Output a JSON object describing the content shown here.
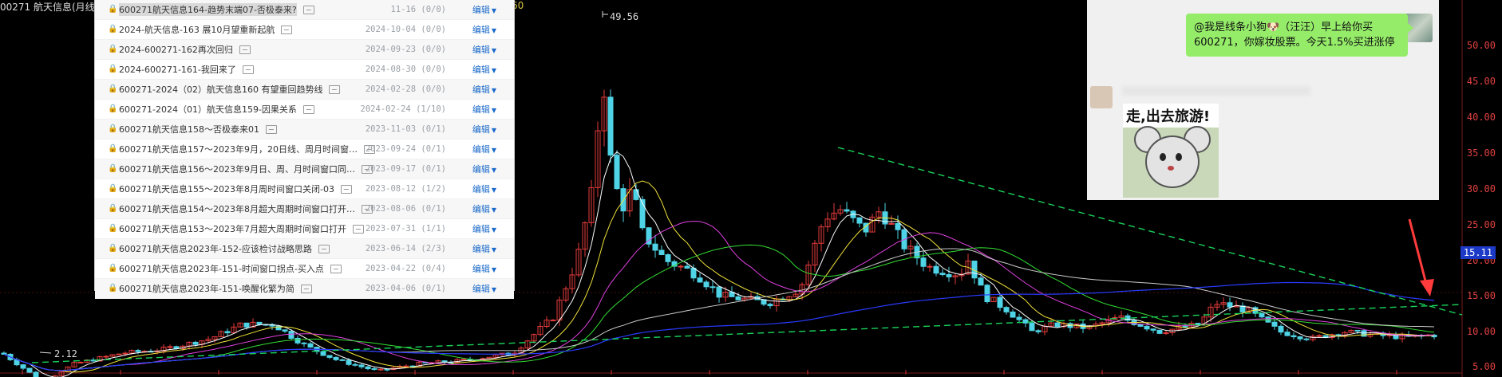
{
  "window": {
    "title": "00271 航天信息(月线"
  },
  "top_indicator": "60",
  "chart": {
    "y_ticks": [
      "50.00",
      "45.00",
      "40.00",
      "35.00",
      "30.00",
      "25.00",
      "20.00",
      "15.00",
      "10.00",
      "5.00"
    ],
    "price_tag": "15.11",
    "high_label": "49.56",
    "low_label": "2.12",
    "colors": {
      "up": "#e43b3b",
      "down": "#4fd3e6",
      "ma5": "#ffffff",
      "ma10": "#f2e33a",
      "ma20": "#e040e0",
      "ma30": "#33dd33",
      "ma60": "#cccccc",
      "ma120": "#2a3bff",
      "trend": "#19d35a",
      "arrow": "#ff3b3b"
    }
  },
  "doc_list": {
    "edit_label": "编辑",
    "items": [
      {
        "name": "600271航天信息164-趋势末端07-否极泰来?",
        "date": "11-16",
        "count": "(0/0)",
        "selected": true
      },
      {
        "name": "2024-航天信息-163 展10月望重新起航",
        "date": "2024-10-04",
        "count": "(0/0)"
      },
      {
        "name": "2024-600271-162再次回归",
        "date": "2024-09-23",
        "count": "(0/0)"
      },
      {
        "name": "2024-600271-161-我回来了",
        "date": "2024-08-30",
        "count": "(0/0)"
      },
      {
        "name": "600271-2024（02）航天信息160 有望重回趋势线",
        "date": "2024-02-28",
        "count": "(0/0)"
      },
      {
        "name": "600271-2024（01）航天信息159-因果关系",
        "date": "2024-02-24",
        "count": "(1/10)"
      },
      {
        "name": "600271航天信息158～否极泰来01",
        "date": "2023-11-03",
        "count": "(0/1)"
      },
      {
        "name": "600271航天信息157～2023年9月，20日线、周月时间窗…",
        "date": "2023-09-24",
        "count": "(0/1)"
      },
      {
        "name": "600271航天信息156～2023年9月日、周、月时间窗口同…",
        "date": "2023-09-17",
        "count": "(0/1)"
      },
      {
        "name": "600271航天信息155～2023年8月周时间窗口关闭-03",
        "date": "2023-08-12",
        "count": "(1/2)"
      },
      {
        "name": "600271航天信息154～2023年8月超大周期时间窗口打开…",
        "date": "2023-08-06",
        "count": "(0/1)"
      },
      {
        "name": "600271航天信息153～2023年7月超大周期时间窗口打开",
        "date": "2023-07-31",
        "count": "(1/1)"
      },
      {
        "name": "600271航天信息2023年-152-应该检讨战略思路",
        "date": "2023-06-14",
        "count": "(2/3)"
      },
      {
        "name": "600271航天信息2023年-151-时间窗口拐点-买入点",
        "date": "2023-04-22",
        "count": "(0/4)"
      },
      {
        "name": "600271航天信息2023年-151-唤醒化繁为简",
        "date": "2023-04-06",
        "count": "(0/1)"
      }
    ]
  },
  "chat": {
    "message": "@我是线条小狗🐶（汪汪）早上给你买600271，你嫁妆股票。今天1.5%买进涨停",
    "sticker_text": "走,出去旅游!"
  }
}
